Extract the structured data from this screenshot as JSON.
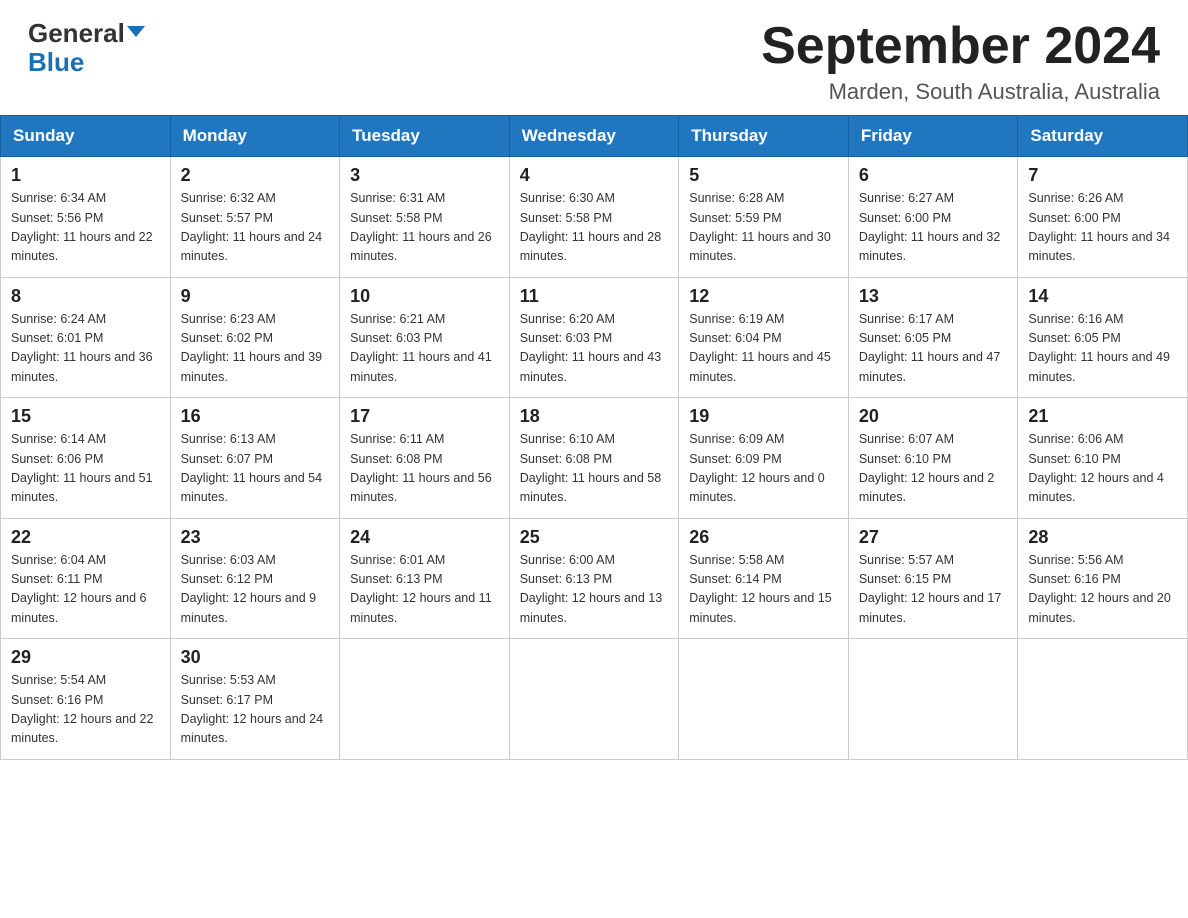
{
  "header": {
    "logo_line1": "General",
    "logo_line2": "Blue",
    "main_title": "September 2024",
    "subtitle": "Marden, South Australia, Australia"
  },
  "calendar": {
    "days_of_week": [
      "Sunday",
      "Monday",
      "Tuesday",
      "Wednesday",
      "Thursday",
      "Friday",
      "Saturday"
    ],
    "weeks": [
      [
        {
          "day": "1",
          "sunrise": "6:34 AM",
          "sunset": "5:56 PM",
          "daylight": "11 hours and 22 minutes."
        },
        {
          "day": "2",
          "sunrise": "6:32 AM",
          "sunset": "5:57 PM",
          "daylight": "11 hours and 24 minutes."
        },
        {
          "day": "3",
          "sunrise": "6:31 AM",
          "sunset": "5:58 PM",
          "daylight": "11 hours and 26 minutes."
        },
        {
          "day": "4",
          "sunrise": "6:30 AM",
          "sunset": "5:58 PM",
          "daylight": "11 hours and 28 minutes."
        },
        {
          "day": "5",
          "sunrise": "6:28 AM",
          "sunset": "5:59 PM",
          "daylight": "11 hours and 30 minutes."
        },
        {
          "day": "6",
          "sunrise": "6:27 AM",
          "sunset": "6:00 PM",
          "daylight": "11 hours and 32 minutes."
        },
        {
          "day": "7",
          "sunrise": "6:26 AM",
          "sunset": "6:00 PM",
          "daylight": "11 hours and 34 minutes."
        }
      ],
      [
        {
          "day": "8",
          "sunrise": "6:24 AM",
          "sunset": "6:01 PM",
          "daylight": "11 hours and 36 minutes."
        },
        {
          "day": "9",
          "sunrise": "6:23 AM",
          "sunset": "6:02 PM",
          "daylight": "11 hours and 39 minutes."
        },
        {
          "day": "10",
          "sunrise": "6:21 AM",
          "sunset": "6:03 PM",
          "daylight": "11 hours and 41 minutes."
        },
        {
          "day": "11",
          "sunrise": "6:20 AM",
          "sunset": "6:03 PM",
          "daylight": "11 hours and 43 minutes."
        },
        {
          "day": "12",
          "sunrise": "6:19 AM",
          "sunset": "6:04 PM",
          "daylight": "11 hours and 45 minutes."
        },
        {
          "day": "13",
          "sunrise": "6:17 AM",
          "sunset": "6:05 PM",
          "daylight": "11 hours and 47 minutes."
        },
        {
          "day": "14",
          "sunrise": "6:16 AM",
          "sunset": "6:05 PM",
          "daylight": "11 hours and 49 minutes."
        }
      ],
      [
        {
          "day": "15",
          "sunrise": "6:14 AM",
          "sunset": "6:06 PM",
          "daylight": "11 hours and 51 minutes."
        },
        {
          "day": "16",
          "sunrise": "6:13 AM",
          "sunset": "6:07 PM",
          "daylight": "11 hours and 54 minutes."
        },
        {
          "day": "17",
          "sunrise": "6:11 AM",
          "sunset": "6:08 PM",
          "daylight": "11 hours and 56 minutes."
        },
        {
          "day": "18",
          "sunrise": "6:10 AM",
          "sunset": "6:08 PM",
          "daylight": "11 hours and 58 minutes."
        },
        {
          "day": "19",
          "sunrise": "6:09 AM",
          "sunset": "6:09 PM",
          "daylight": "12 hours and 0 minutes."
        },
        {
          "day": "20",
          "sunrise": "6:07 AM",
          "sunset": "6:10 PM",
          "daylight": "12 hours and 2 minutes."
        },
        {
          "day": "21",
          "sunrise": "6:06 AM",
          "sunset": "6:10 PM",
          "daylight": "12 hours and 4 minutes."
        }
      ],
      [
        {
          "day": "22",
          "sunrise": "6:04 AM",
          "sunset": "6:11 PM",
          "daylight": "12 hours and 6 minutes."
        },
        {
          "day": "23",
          "sunrise": "6:03 AM",
          "sunset": "6:12 PM",
          "daylight": "12 hours and 9 minutes."
        },
        {
          "day": "24",
          "sunrise": "6:01 AM",
          "sunset": "6:13 PM",
          "daylight": "12 hours and 11 minutes."
        },
        {
          "day": "25",
          "sunrise": "6:00 AM",
          "sunset": "6:13 PM",
          "daylight": "12 hours and 13 minutes."
        },
        {
          "day": "26",
          "sunrise": "5:58 AM",
          "sunset": "6:14 PM",
          "daylight": "12 hours and 15 minutes."
        },
        {
          "day": "27",
          "sunrise": "5:57 AM",
          "sunset": "6:15 PM",
          "daylight": "12 hours and 17 minutes."
        },
        {
          "day": "28",
          "sunrise": "5:56 AM",
          "sunset": "6:16 PM",
          "daylight": "12 hours and 20 minutes."
        }
      ],
      [
        {
          "day": "29",
          "sunrise": "5:54 AM",
          "sunset": "6:16 PM",
          "daylight": "12 hours and 22 minutes."
        },
        {
          "day": "30",
          "sunrise": "5:53 AM",
          "sunset": "6:17 PM",
          "daylight": "12 hours and 24 minutes."
        },
        null,
        null,
        null,
        null,
        null
      ]
    ]
  }
}
